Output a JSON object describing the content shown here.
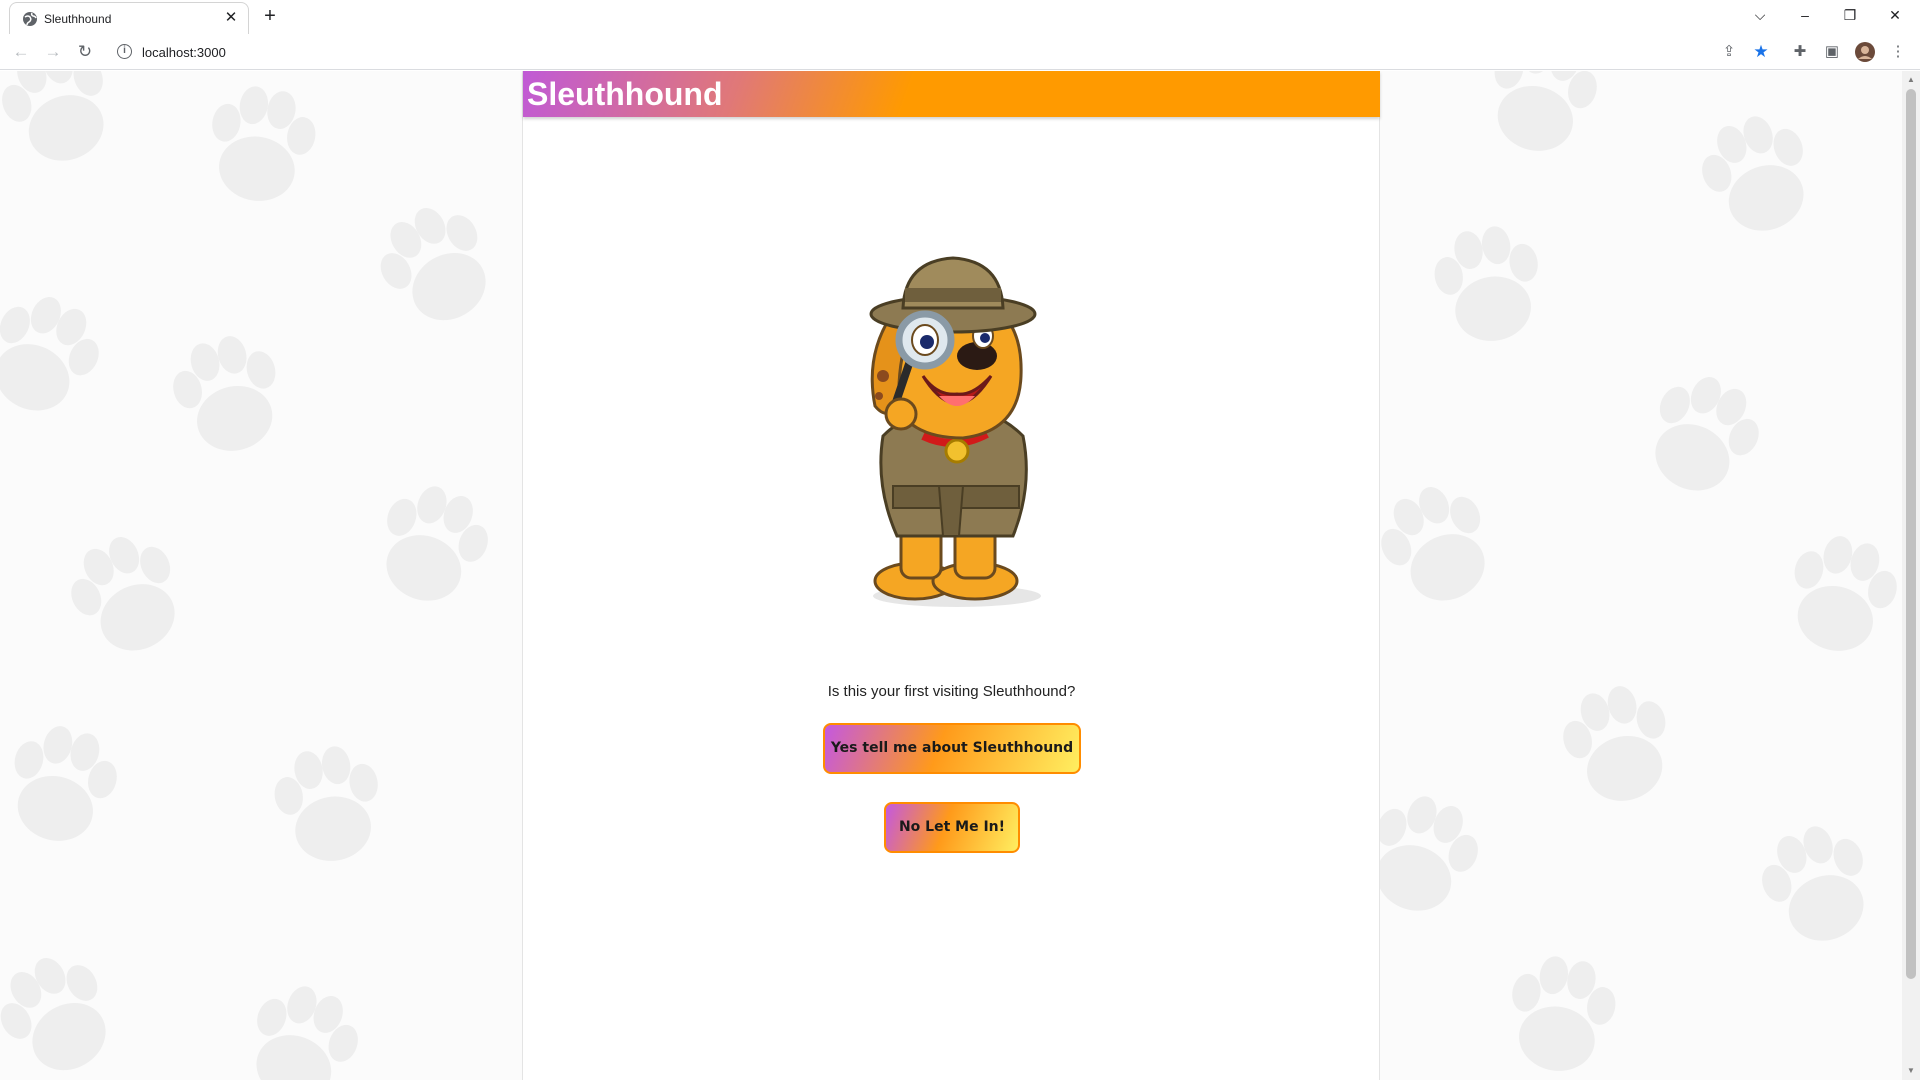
{
  "browser": {
    "tab_title": "Sleuthhound",
    "tab_close": "✕",
    "new_tab": "+",
    "url": "localhost:3000",
    "controls": {
      "tab_search": "⌵",
      "minimize": "–",
      "restore": "❐",
      "close": "✕"
    },
    "nav": {
      "back": "←",
      "forward": "→",
      "reload": "↻"
    },
    "toolbar_icons": {
      "share": "⇪",
      "bookmark": "★",
      "extensions": "✚",
      "side_panel": "▣",
      "menu": "⋮"
    },
    "accent": "#1a73e8"
  },
  "page": {
    "brand": "Sleuthhound",
    "question": "Is this your first visiting Sleuthhound?",
    "yes_button": "Yes tell me about Sleuthhound",
    "no_button": "No Let Me In!",
    "header_gradient": [
      "#c05ad6",
      "#ff9a00"
    ],
    "button_border": "#ff8c00"
  }
}
